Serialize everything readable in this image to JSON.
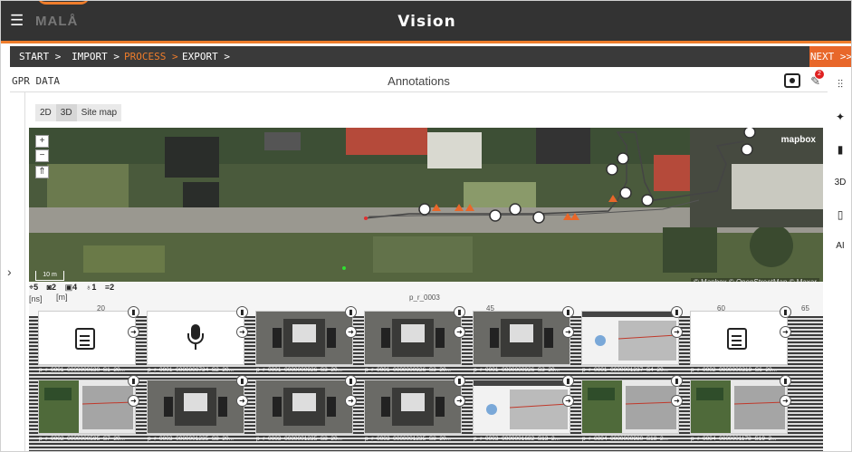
{
  "app": {
    "logo": "MALÅ",
    "title": "Vision"
  },
  "nav": {
    "steps": [
      {
        "label": "START >",
        "active": false
      },
      {
        "label": "IMPORT >",
        "active": false
      },
      {
        "label": "PROCESS >",
        "active": true
      },
      {
        "label": "EXPORT >",
        "active": false
      }
    ],
    "next_label": "NEXT >>"
  },
  "subheader": {
    "section": "GPR DATA",
    "title": "Annotations",
    "notification_count": "2"
  },
  "right_tools": {
    "items": [
      {
        "icon": "sliders-icon",
        "label": "⫶⫶"
      },
      {
        "icon": "pin-icon",
        "label": "✦"
      },
      {
        "icon": "chart-icon",
        "label": "▮"
      },
      {
        "icon": "3d-label",
        "label": "3D"
      },
      {
        "icon": "map-icon",
        "label": "▯"
      },
      {
        "icon": "ai-label",
        "label": "AI"
      }
    ]
  },
  "view_tabs": [
    {
      "label": "2D",
      "selected": false
    },
    {
      "label": "3D",
      "selected": true
    },
    {
      "label": "Site map",
      "selected": false
    }
  ],
  "map": {
    "zoom_in": "+",
    "zoom_out": "−",
    "compass": "⇑",
    "scale_label": "10 m",
    "mapbox_label": "mapbox",
    "attribution": "© Mapbox © OpenStreetMap © Maxar"
  },
  "bottom": {
    "counts": [
      {
        "icon": "target-icon",
        "value": "5"
      },
      {
        "icon": "camera-icon",
        "value": "2"
      },
      {
        "icon": "photo-icon",
        "value": "4"
      },
      {
        "icon": "mic-icon",
        "value": "1"
      },
      {
        "icon": "note-icon",
        "value": "2"
      }
    ],
    "unit_m": "[m]",
    "unit_ns": "[ns]",
    "track_name": "p_r_0003",
    "x_ticks": [
      "20",
      "45",
      "60",
      "65"
    ]
  },
  "thumbnails": [
    {
      "type": "note",
      "caption": "p_r_0001_0000000630_S1_20..."
    },
    {
      "type": "mic",
      "caption": "p_r_0001_0000000734_S2_20..."
    },
    {
      "type": "photo-vehicle",
      "caption": "p_r_0001_0000000926_S3_20..."
    },
    {
      "type": "photo-vehicle",
      "caption": "p_r_0001_0000000926_S3_20..."
    },
    {
      "type": "photo-vehicle",
      "caption": "p_r_0001_0000000926_S3_20..."
    },
    {
      "type": "screenshot",
      "caption": "p_r_0001_0000001237_S4_20..."
    },
    {
      "type": "note",
      "caption": "p_r_0002_0000000319_S6_20..."
    },
    {
      "type": "screenshot-map",
      "caption": "p_r_0002_0000000595_S7_20..."
    },
    {
      "type": "photo-vehicle",
      "caption": "p_r_0003_0000001235_S8_20..."
    },
    {
      "type": "photo-vehicle",
      "caption": "p_r_0003_0000001235_S8_20..."
    },
    {
      "type": "photo-vehicle",
      "caption": "p_r_0003_0000001235_S8_20..."
    },
    {
      "type": "screenshot",
      "caption": "p_r_0003_0000001682_S13_2..."
    },
    {
      "type": "screenshot-map",
      "caption": "p_r_0004_0000000980_S18_2..."
    },
    {
      "type": "screenshot-map",
      "caption": "p_r_0004_0000001178_S19_2..."
    }
  ],
  "colors": {
    "accent": "#ef7d2b",
    "titlebar": "#333333",
    "nav_next": "#e8672a"
  }
}
